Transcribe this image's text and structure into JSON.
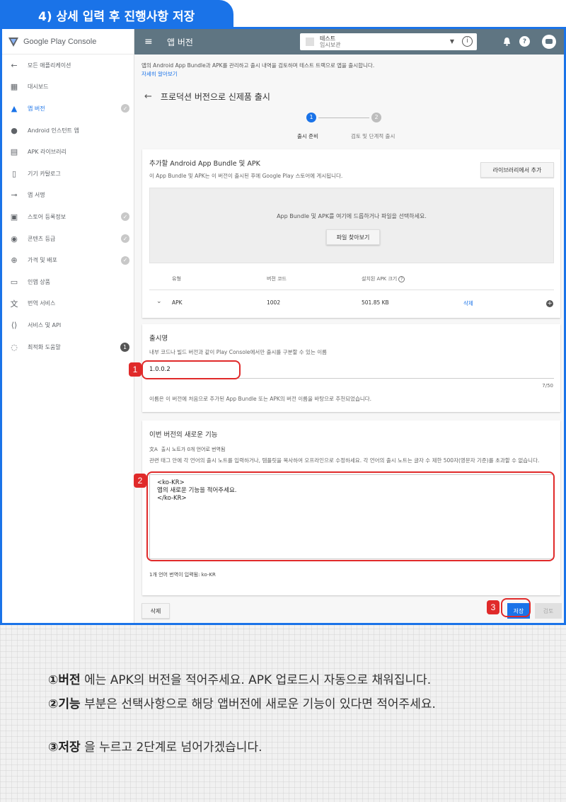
{
  "banner": {
    "title": "4) 상세 입력 후 진행사항 저장"
  },
  "sidebar": {
    "brand": "Google Play Console",
    "items": [
      {
        "label": "모든 애플리케이션",
        "icon": "back-arrow-icon",
        "glyph": "←"
      },
      {
        "label": "대시보드",
        "icon": "dashboard-icon",
        "glyph": "▦"
      },
      {
        "label": "앱 버전",
        "icon": "rocket-icon",
        "glyph": "▲",
        "active": true,
        "check": true
      },
      {
        "label": "Android 인스턴트 앱",
        "icon": "bolt-icon",
        "glyph": "●"
      },
      {
        "label": "APK 라이브러리",
        "icon": "library-icon",
        "glyph": "▤"
      },
      {
        "label": "기기 카탈로그",
        "icon": "device-icon",
        "glyph": "▯"
      },
      {
        "label": "앱 서명",
        "icon": "key-icon",
        "glyph": "⊸"
      },
      {
        "label": "스토어 등록정보",
        "icon": "store-icon",
        "glyph": "▣",
        "check": true
      },
      {
        "label": "콘텐츠 등급",
        "icon": "rating-icon",
        "glyph": "◉",
        "check": true
      },
      {
        "label": "가격 및 배포",
        "icon": "globe-icon",
        "glyph": "⊕",
        "check": true
      },
      {
        "label": "인앱 상품",
        "icon": "card-icon",
        "glyph": "▭"
      },
      {
        "label": "번역 서비스",
        "icon": "translate-icon",
        "glyph": "文"
      },
      {
        "label": "서비스 및 API",
        "icon": "api-icon",
        "glyph": "⟨⟩"
      },
      {
        "label": "최적화 도움말",
        "icon": "bulb-icon",
        "glyph": "◌",
        "badge": "1"
      }
    ]
  },
  "header": {
    "menu_glyph": "≡",
    "title": "앱 버전",
    "app_name": "테스트",
    "app_status": "임시보관",
    "caret": "▼",
    "info": "i",
    "bell": "🔔",
    "help": "?"
  },
  "main": {
    "description": "앱의 Android App Bundle과 APK를 관리하고 출시 내역을 검토하며 테스트 트랙으로 앱을 출시합니다.",
    "learn_more": "자세히 알아보기",
    "page_title": "프로덕션 버전으로 신제품 출시",
    "back": "←",
    "steps": [
      {
        "num": "1",
        "label": "출시 준비"
      },
      {
        "num": "2",
        "label": "검토 및 단계적 출시"
      }
    ],
    "bundle_card": {
      "title": "추가할 Android App Bundle 및 APK",
      "subtitle": "이 App Bundle 및 APK는 이 버전이 출시된 후에 Google Play 스토어에 게시됩니다.",
      "add_from_library": "라이브러리에서 추가",
      "drop_text": "App Bundle 및 APK를 여기에 드롭하거나 파일을 선택하세요.",
      "browse_files": "파일 찾아보기",
      "columns": [
        "유형",
        "버전 코드",
        "설치된 APK 크기"
      ],
      "row": {
        "type": "APK",
        "version_code": "1002",
        "size": "501.85 KB",
        "action": "삭제"
      }
    },
    "release_name_card": {
      "title": "출시명",
      "subtitle": "내부 코드나 빌드 버전과 같이 Play Console에서만 출시를 구분할 수 있는 이름",
      "value": "1.0.0.2",
      "counter": "7/50",
      "hint": "이름은 이 버전에 처음으로 추가된 App Bundle 또는 APK의 버전 이름을 바탕으로 추천되었습니다."
    },
    "whats_new_card": {
      "title": "이번 버전의 새로운 기능",
      "translate_note": "출시 노트가 0개 언어로 번역됨",
      "instructions": "관련 태그 안에 각 언어의 출시 노트를 입력하거나, 템플릿을 복사하여 오프라인으로 수정하세요. 각 언어의 출시 노트는 글자 수 제한 500자(영문자 기준)를 초과할 수 없습니다.",
      "notes": "<ko-KR>\n앱의 새로운 기능을 적어주세요.\n</ko-KR>",
      "lang_count": "1개 언어 번역이 입력됨: ko-KR"
    },
    "delete_button": "삭제",
    "save_button": "저장",
    "review_button": "검토"
  },
  "annotations": {
    "one": "1",
    "two": "2",
    "three": "3",
    "color": "#e02a2a"
  },
  "instructions": [
    {
      "bold": "①버전",
      "text": " 에는 APK의 버전을 적어주세요. APK 업로드시 자동으로 채워집니다."
    },
    {
      "bold": "②기능",
      "text": " 부분은 선택사항으로 해당 앱버전에 새로운 기능이 있다면 적어주세요."
    },
    {
      "bold": "③저장",
      "text": " 을 누르고 2단계로 넘어가겠습니다."
    }
  ],
  "colors": {
    "accent": "#1a73e8",
    "header": "#5f7582"
  }
}
